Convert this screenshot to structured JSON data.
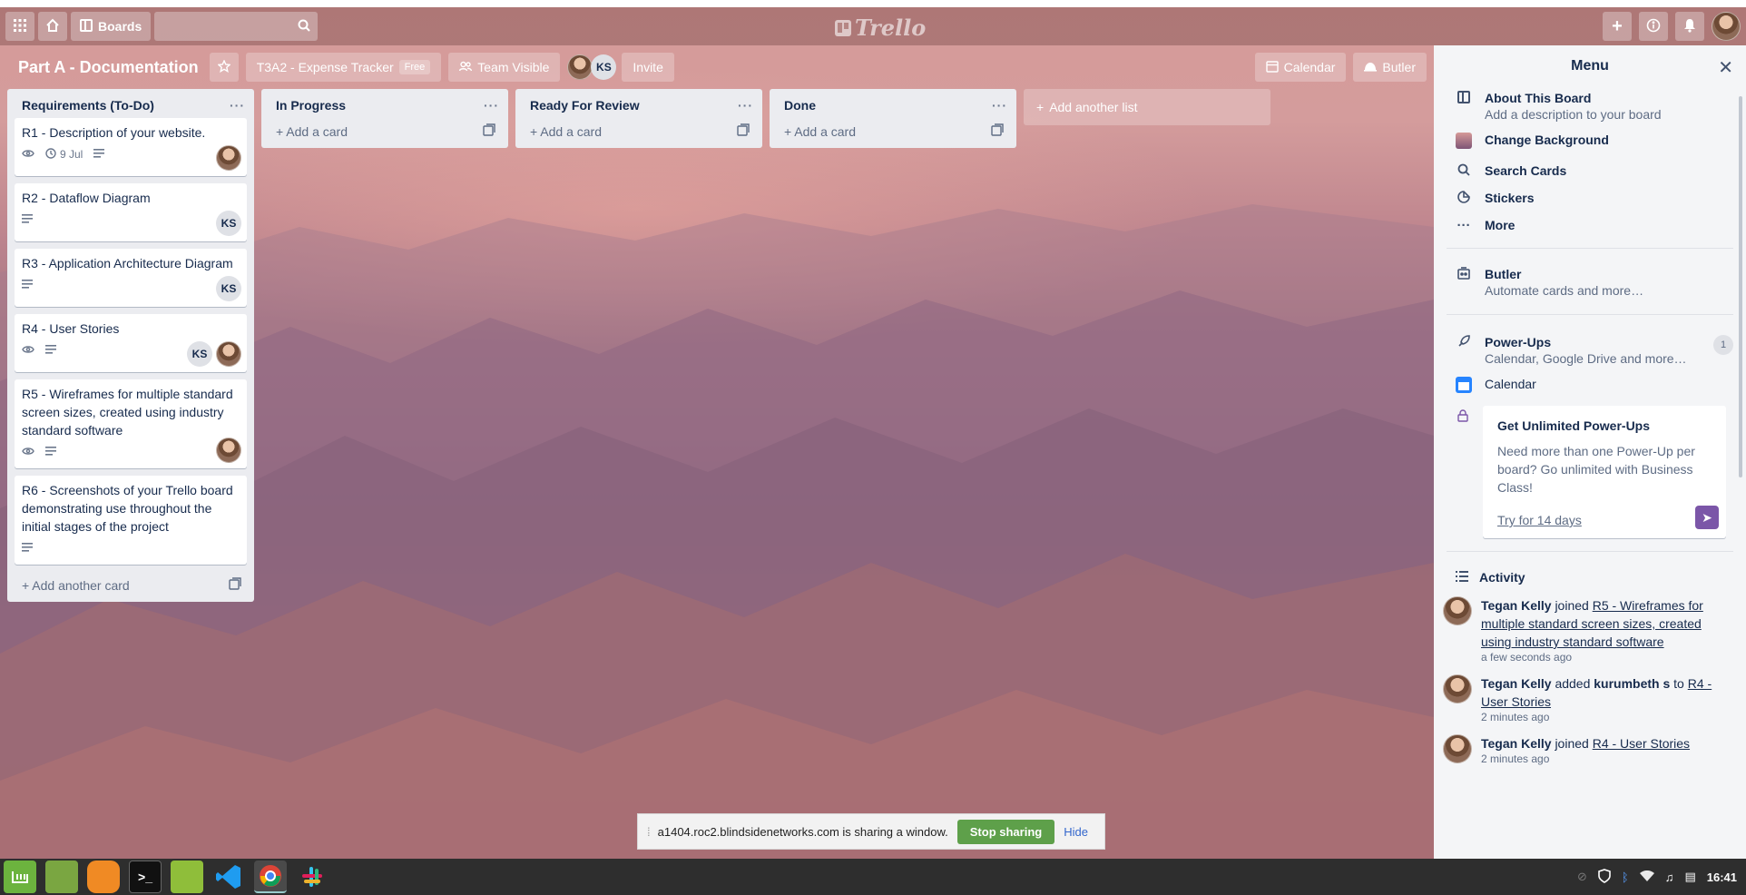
{
  "header": {
    "boards_label": "Boards",
    "logo_text": "Trello"
  },
  "board": {
    "title": "Part A - Documentation",
    "team_name": "T3A2 - Expense Tracker",
    "team_badge": "Free",
    "visibility": "Team Visible",
    "member_initials": "KS",
    "invite_label": "Invite",
    "calendar_label": "Calendar",
    "butler_label": "Butler"
  },
  "lists": [
    {
      "title": "Requirements (To-Do)",
      "add_label": "Add another card",
      "cards": [
        {
          "title": "R1 - Description of your website.",
          "due": "9 Jul"
        },
        {
          "title": "R2 - Dataflow Diagram",
          "member": "KS"
        },
        {
          "title": "R3 - Application Architecture Diagram",
          "member": "KS"
        },
        {
          "title": "R4 - User Stories",
          "member": "KS"
        },
        {
          "title": "R5 - Wireframes for multiple standard screen sizes, created using industry standard software"
        },
        {
          "title": "R6 - Screenshots of your Trello board demonstrating use throughout the initial stages of the project"
        }
      ]
    },
    {
      "title": "In Progress",
      "add_label": "Add a card"
    },
    {
      "title": "Ready For Review",
      "add_label": "Add a card"
    },
    {
      "title": "Done",
      "add_label": "Add a card"
    }
  ],
  "add_list_label": "Add another list",
  "menu": {
    "title": "Menu",
    "about_title": "About This Board",
    "about_sub": "Add a description to your board",
    "change_bg": "Change Background",
    "search_cards": "Search Cards",
    "stickers": "Stickers",
    "more": "More",
    "butler_title": "Butler",
    "butler_sub": "Automate cards and more…",
    "powerups_title": "Power-Ups",
    "powerups_sub": "Calendar, Google Drive and more…",
    "powerups_count": "1",
    "calendar": "Calendar",
    "promo_title": "Get Unlimited Power-Ups",
    "promo_text": "Need more than one Power-Up per board? Go unlimited with Business Class!",
    "promo_link": "Try for 14 days",
    "activity_title": "Activity",
    "activity": [
      {
        "user": "Tegan Kelly",
        "action": "joined",
        "target": "R5 - Wireframes for multiple standard screen sizes, created using industry standard software",
        "time": "a few seconds ago"
      },
      {
        "user": "Tegan Kelly",
        "action": "added",
        "object": "kurumbeth s",
        "to": "to",
        "target": "R4 - User Stories",
        "time": "2 minutes ago"
      },
      {
        "user": "Tegan Kelly",
        "action": "joined",
        "target": "R4 - User Stories",
        "time": "2 minutes ago"
      }
    ]
  },
  "share": {
    "text": "a1404.roc2.blindsidenetworks.com is sharing a window.",
    "stop_label": "Stop sharing",
    "hide_label": "Hide"
  },
  "taskbar": {
    "clock": "16:41"
  }
}
